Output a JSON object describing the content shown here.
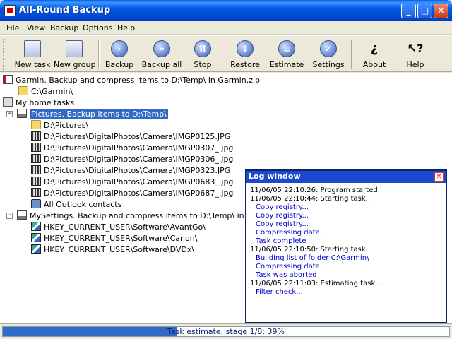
{
  "window": {
    "title": "All-Round Backup"
  },
  "menu": [
    "File",
    "View",
    "Backup",
    "Options",
    "Help"
  ],
  "toolbar": {
    "new_task": "New task",
    "new_group": "New group",
    "backup": "Backup",
    "backup_all": "Backup all",
    "stop": "Stop",
    "restore": "Restore",
    "estimate": "Estimate",
    "settings": "Settings",
    "about": "About",
    "help": "Help"
  },
  "tree": {
    "garmin": "Garmin. Backup and compress items to D:\\Temp\\ in Garmin.zip",
    "garmin_folder": "C:\\Garmin\\",
    "home_tasks": "My home tasks",
    "pictures": "Pictures. Backup items to D:\\Temp\\",
    "pictures_folder": "D:\\Pictures\\",
    "files": [
      "D:\\Pictures\\DigitalPhotos\\Camera\\IMGP0125.JPG",
      "D:\\Pictures\\DigitalPhotos\\Camera\\IMGP0307_.jpg",
      "D:\\Pictures\\DigitalPhotos\\Camera\\IMGP0306_.jpg",
      "D:\\Pictures\\DigitalPhotos\\Camera\\IMGP0323.JPG",
      "D:\\Pictures\\DigitalPhotos\\Camera\\IMGP0683_.jpg",
      "D:\\Pictures\\DigitalPhotos\\Camera\\IMGP0687_.jpg"
    ],
    "outlook": "All Outlook contacts",
    "mysettings": "MySettings. Backup and compress items to D:\\Temp\\ in MySettings",
    "registry": [
      "HKEY_CURRENT_USER\\Software\\AvantGo\\",
      "HKEY_CURRENT_USER\\Software\\Canon\\",
      "HKEY_CURRENT_USER\\Software\\DVDx\\"
    ]
  },
  "log": {
    "title": "Log window",
    "lines": [
      "11/06/05 22:10:26: Program started",
      "11/06/05 22:10:44: Starting task...",
      "Copy registry...",
      "Copy registry...",
      "Copy registry...",
      "Compressing data...",
      "Task complete",
      "11/06/05 22:10:50: Starting task...",
      "Building list of folder C:\\Garmin\\",
      "Compressing data...",
      "Task was aborted",
      "11/06/05 22:11:03: Estimating task...",
      "Filter check..."
    ]
  },
  "status": {
    "text": "Task estimate, stage 1/8: 39%",
    "progress": 0.39
  }
}
